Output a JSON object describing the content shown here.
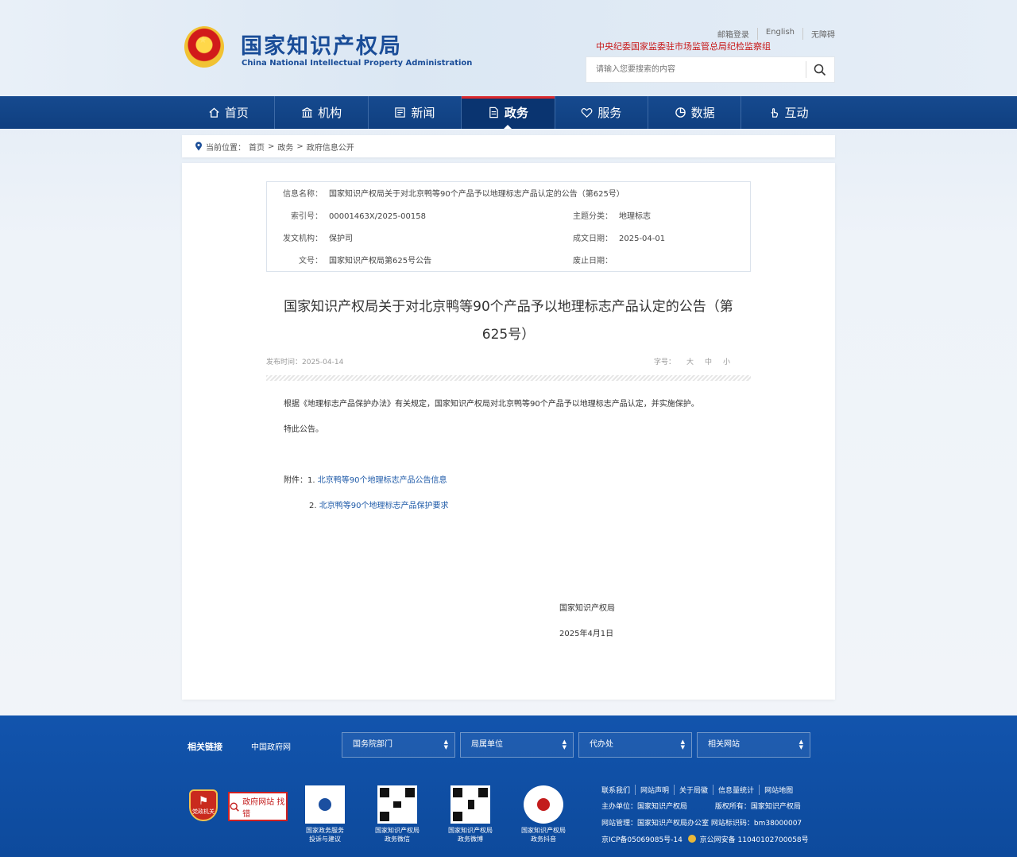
{
  "header": {
    "logo_cn": "国家知识产权局",
    "logo_en": "China National Intellectual Property Administration",
    "top_links": [
      "邮箱登录",
      "English",
      "无障碍"
    ],
    "jijian": "中央纪委国家监委驻市场监管总局纪检监察组",
    "search_placeholder": "请输入您要搜索的内容"
  },
  "nav": [
    {
      "label": "首页",
      "icon": "home-icon"
    },
    {
      "label": "机构",
      "icon": "institution-icon"
    },
    {
      "label": "新闻",
      "icon": "news-icon"
    },
    {
      "label": "政务",
      "icon": "document-icon",
      "active": true
    },
    {
      "label": "服务",
      "icon": "service-icon"
    },
    {
      "label": "数据",
      "icon": "pie-chart-icon"
    },
    {
      "label": "互动",
      "icon": "hand-icon"
    }
  ],
  "breadcrumb": {
    "prefix": "当前位置：",
    "items": [
      "首页",
      "政务",
      "政府信息公开"
    ],
    "sep": ">"
  },
  "info": {
    "name_label": "信息名称：",
    "name_value": "国家知识产权局关于对北京鸭等90个产品予以地理标志产品认定的公告（第625号）",
    "index_label": "索引号：",
    "index_value": "00001463X/2025-00158",
    "category_label": "主题分类：",
    "category_value": "地理标志",
    "issuer_label": "发文机构：",
    "issuer_value": "保护司",
    "date_label": "成文日期：",
    "date_value": "2025-04-01",
    "docno_label": "文号：",
    "docno_value": "国家知识产权局第625号公告",
    "expire_label": "废止日期：",
    "expire_value": ""
  },
  "article": {
    "title_line1": "国家知识产权局关于对北京鸭等90个产品予以地理标志产品认定的公告（第",
    "title_line2": "625号）",
    "publish_time": "发布时间：2025-04-14",
    "font_size_label": "字号：",
    "font_sizes": [
      "大",
      "中",
      "小"
    ],
    "paragraph1": "根据《地理标志产品保护办法》有关规定，国家知识产权局对北京鸭等90个产品予以地理标志产品认定，并实施保护。",
    "paragraph2": "特此公告。",
    "attach_label": "附件：",
    "attach1_no": "1. ",
    "attach1": "北京鸭等90个地理标志产品公告信息",
    "attach2_no": "2. ",
    "attach2": "北京鸭等90个地理标志产品保护要求",
    "sign_org": "国家知识产权局",
    "sign_date": "2025年4月1日"
  },
  "footer": {
    "related_title": "相关链接",
    "gov_link": "中国政府网",
    "selects": [
      "国务院部门",
      "局属单位",
      "代办处",
      "相关网站"
    ],
    "badge_red": "党政机关",
    "badge_jc_text": "政府网站 找错",
    "qr_captions": [
      [
        "国家政务服务",
        "投诉与建议"
      ],
      [
        "国家知识产权局",
        "政务微信"
      ],
      [
        "国家知识产权局",
        "政务微博"
      ],
      [
        "国家知识产权局",
        "政务抖音"
      ]
    ],
    "links": [
      "联系我们",
      "网站声明",
      "关于局徽",
      "信息量统计",
      "网站地图"
    ],
    "host": "主办单位：国家知识产权局",
    "copyright": "版权所有：国家知识产权局",
    "manage": "网站管理：国家知识产权局办公室 网站标识码：bm38000007",
    "icp": "京ICP备05069085号-14",
    "police": "京公网安备 11040102700058号"
  }
}
